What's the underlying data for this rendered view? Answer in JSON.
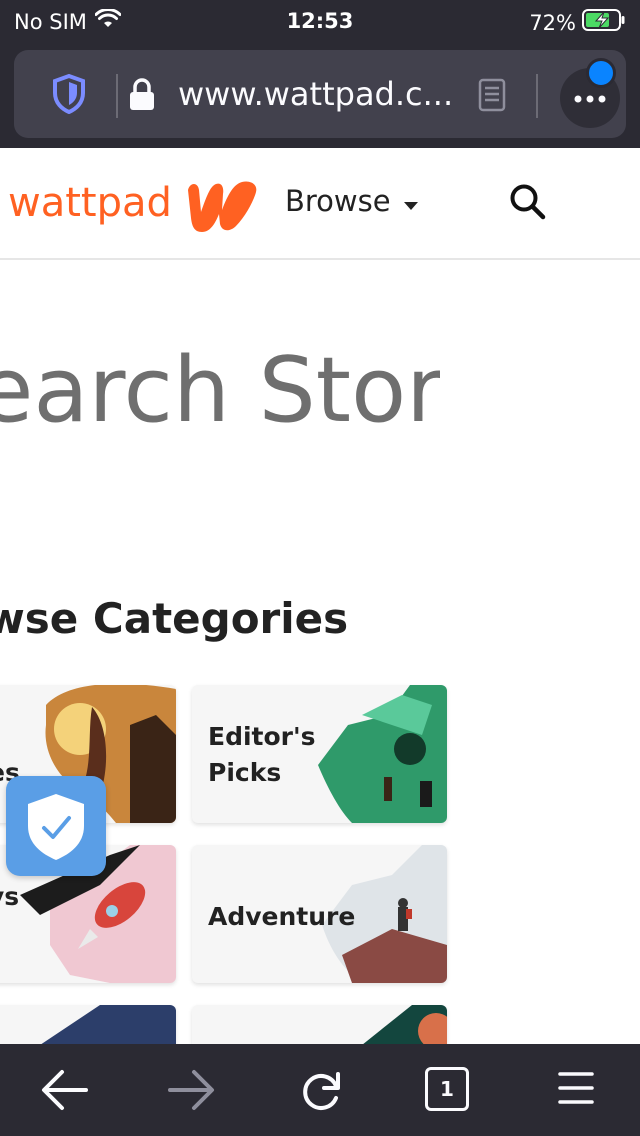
{
  "status_bar": {
    "carrier": "No SIM",
    "time": "12:53",
    "battery": "72%"
  },
  "browser": {
    "url": "www.wattpad.c...",
    "tab_count": "1"
  },
  "site": {
    "logo_text": "wattpad",
    "browse_label": "Browse",
    "hero_text": "earch Storie",
    "categories_title": "wse Categories"
  },
  "categories": [
    {
      "label": "es"
    },
    {
      "label": "Editor's\nPicks"
    },
    {
      "label": "ys"
    },
    {
      "label": "Adventure"
    }
  ],
  "colors": {
    "brand": "#ff6122",
    "chrome": "#2b2a33",
    "urlbar": "#42414d",
    "accent_blue": "#0a84ff",
    "shield_blue": "#5a9ee6"
  }
}
